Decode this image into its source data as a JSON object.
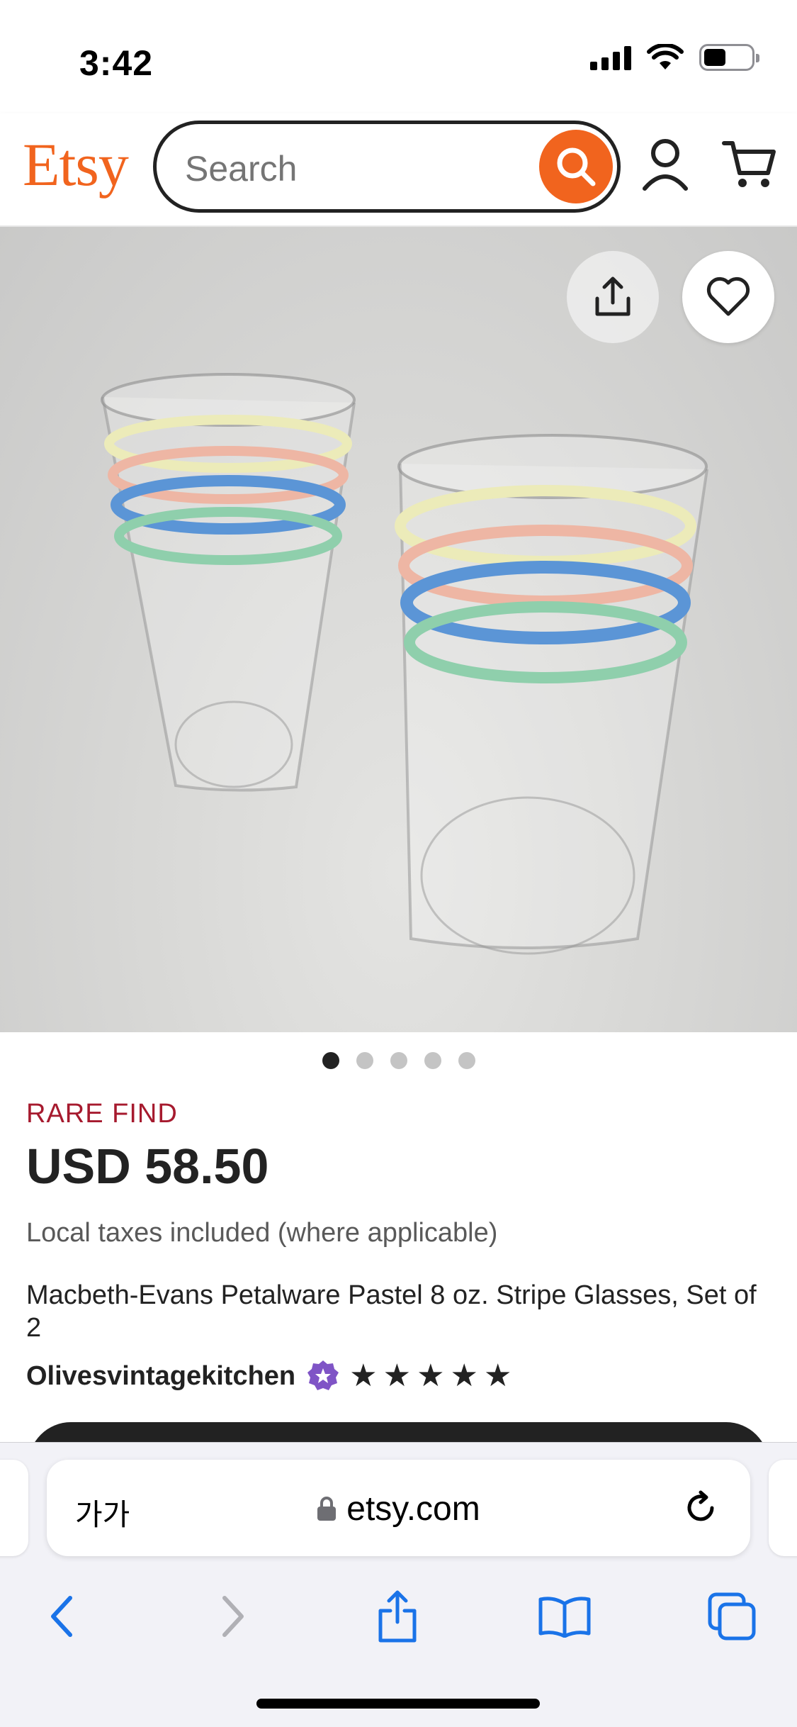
{
  "status_bar": {
    "time": "3:42"
  },
  "header": {
    "logo": "Etsy",
    "search_placeholder": "Search",
    "accent_color": "#f1641e"
  },
  "product": {
    "image_alt": "Two clear glass tumblers with pastel yellow, pink, blue and green stripes",
    "image_count": 5,
    "active_image": 1,
    "badge": "RARE FIND",
    "price": "USD 58.50",
    "tax_note": "Local taxes included (where applicable)",
    "title": "Macbeth-Evans Petalware Pastel 8 oz. Stripe Glasses, Set of 2",
    "shop_name": "Olivesvintagekitchen",
    "rating_stars": 5
  },
  "browser": {
    "text_size_button": "가가",
    "url": "etsy.com"
  },
  "icons": [
    "search-icon",
    "account-icon",
    "cart-icon",
    "share-icon",
    "heart-icon",
    "star-seller-icon",
    "star-icon",
    "lock-icon",
    "reload-icon",
    "back-icon",
    "forward-icon",
    "bookmarks-icon",
    "tabs-icon"
  ]
}
